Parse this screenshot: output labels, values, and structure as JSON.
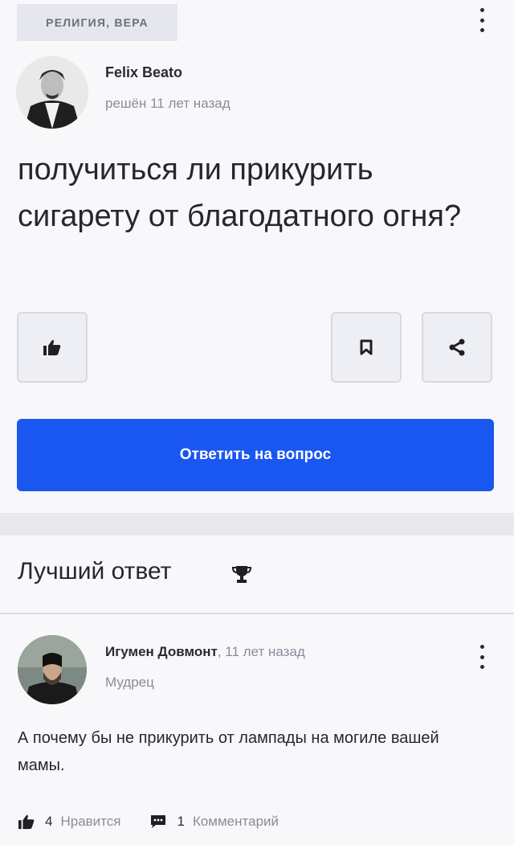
{
  "question": {
    "category": "РЕЛИГИЯ, ВЕРА",
    "author_name": "Felix Beato",
    "author_meta": "решён 11 лет назад",
    "text": "получиться ли прикурить сигарету от благодатного огня?",
    "answer_button": "Ответить на вопрос",
    "icons": [
      "like-icon",
      "bookmark-icon",
      "share-icon",
      "more-icon"
    ]
  },
  "best_answer": {
    "title": "Лучший ответ",
    "author_name": "Игумен Довмонт",
    "time": ", 11 лет назад",
    "rank": "Мудрец",
    "text": "А почему бы не прикурить от лампады на могиле вашей мамы.",
    "likes_count": "4",
    "likes_label": "Нравится",
    "comments_count": "1",
    "comments_label": "Комментарий"
  },
  "colors": {
    "accent": "#1a56f0",
    "background": "#f8f8fb",
    "muted_text": "#8a8c98"
  }
}
